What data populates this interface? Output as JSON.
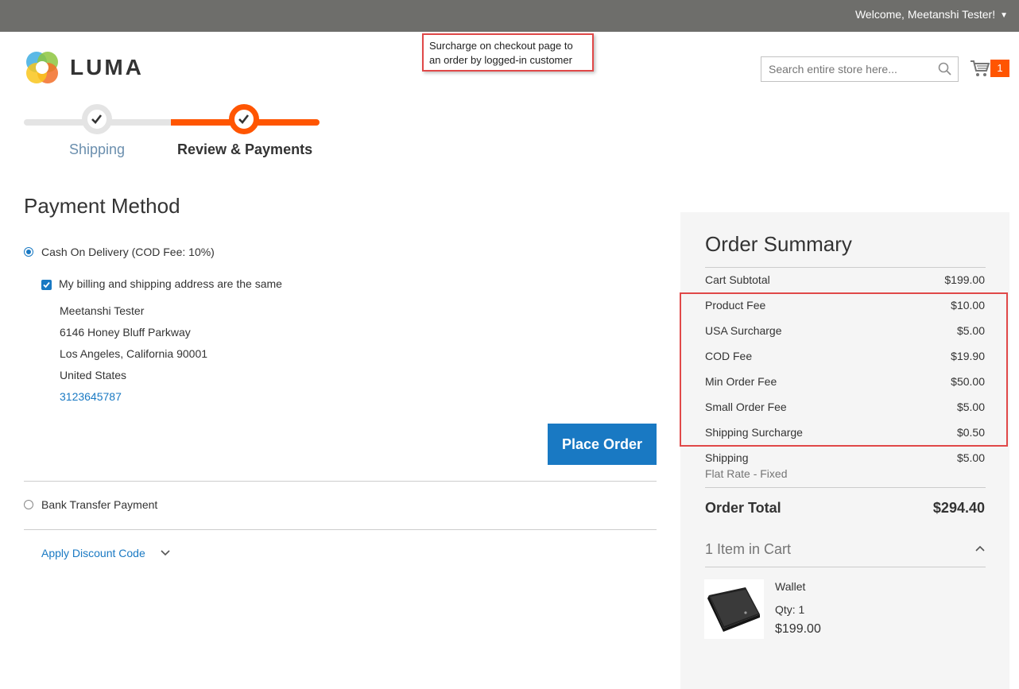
{
  "header": {
    "welcome_text": "Welcome, Meetanshi Tester!",
    "search_placeholder": "Search entire store here...",
    "cart_count": "1",
    "logo_text": "LUMA"
  },
  "annotation": {
    "note": "Surcharge on checkout page to an order by logged-in customer"
  },
  "progress": {
    "steps": [
      {
        "label": "Shipping",
        "state": "complete"
      },
      {
        "label": "Review & Payments",
        "state": "active"
      }
    ]
  },
  "payment": {
    "title": "Payment Method",
    "methods": [
      {
        "label": "Cash On Delivery (COD Fee: 10%)",
        "selected": true
      },
      {
        "label": "Bank Transfer Payment",
        "selected": false
      }
    ],
    "billing_same_label": "My billing and shipping address are the same",
    "billing_same_checked": true,
    "address": {
      "name": "Meetanshi Tester",
      "street": "6146 Honey Bluff Parkway",
      "city_line": "Los Angeles, California 90001",
      "country": "United States",
      "phone": "3123645787"
    },
    "place_order_label": "Place Order",
    "discount_label": "Apply Discount Code"
  },
  "summary": {
    "title": "Order Summary",
    "rows": [
      {
        "label": "Cart Subtotal",
        "value": "$199.00"
      },
      {
        "label": "Product Fee",
        "value": "$10.00"
      },
      {
        "label": "USA Surcharge",
        "value": "$5.00"
      },
      {
        "label": "COD Fee",
        "value": "$19.90"
      },
      {
        "label": "Min Order Fee",
        "value": "$50.00"
      },
      {
        "label": "Small Order Fee",
        "value": "$5.00"
      },
      {
        "label": "Shipping Surcharge",
        "value": "$0.50"
      },
      {
        "label": "Shipping",
        "value": "$5.00"
      }
    ],
    "shipping_method": "Flat Rate - Fixed",
    "total_label": "Order Total",
    "total_value": "$294.40",
    "items_in_cart": "1 Item in Cart",
    "item": {
      "name": "Wallet",
      "qty": "Qty: 1",
      "price": "$199.00"
    }
  },
  "colors": {
    "accent_blue": "#1979c3",
    "accent_orange": "#ff5501",
    "highlight_red": "#e04848",
    "topbar": "#6e6e6b"
  }
}
